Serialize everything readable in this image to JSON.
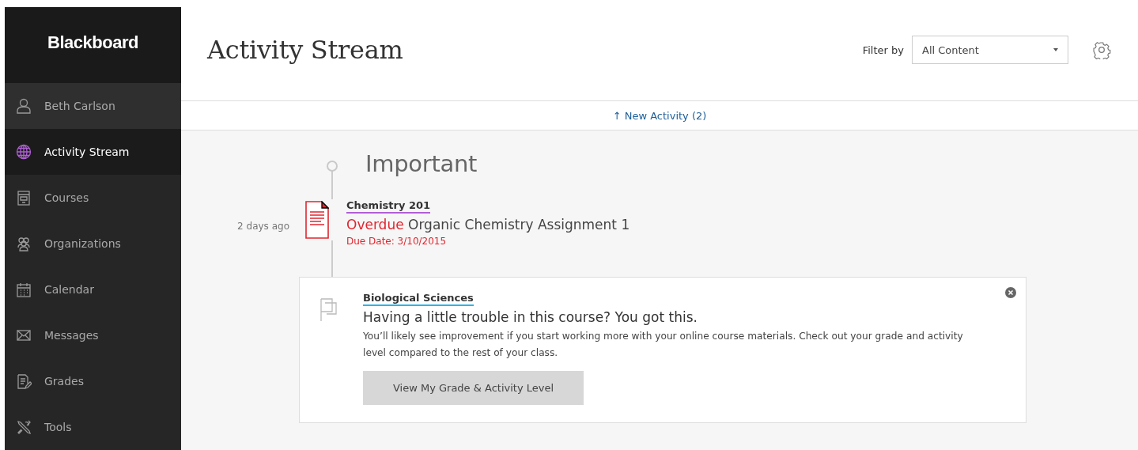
{
  "sidebar": {
    "logo": "Blackboard",
    "items": [
      {
        "label": "Beth Carlson",
        "kind": "profile",
        "selected": false
      },
      {
        "label": "Activity Stream",
        "kind": "nav",
        "selected": true
      },
      {
        "label": "Courses",
        "kind": "nav",
        "selected": false
      },
      {
        "label": "Organizations",
        "kind": "nav",
        "selected": false
      },
      {
        "label": "Calendar",
        "kind": "nav",
        "selected": false
      },
      {
        "label": "Messages",
        "kind": "nav",
        "selected": false
      },
      {
        "label": "Grades",
        "kind": "nav",
        "selected": false
      },
      {
        "label": "Tools",
        "kind": "nav",
        "selected": false
      }
    ]
  },
  "header": {
    "title": "Activity Stream",
    "filter_label": "Filter by",
    "filter_value": "All Content"
  },
  "new_activity": "↑ New Activity (2)",
  "section": {
    "title": "Important"
  },
  "items": [
    {
      "kind": "assignment",
      "time": "2 days ago",
      "course": "Chemistry 201",
      "color": "#b05fd6",
      "status": "Overdue",
      "title": "Organic Chemistry Assignment 1",
      "due": "Due Date: 3/10/2015"
    },
    {
      "kind": "notice",
      "course": "Biological Sciences",
      "color": "#29b6e8",
      "title": "Having a little trouble in this course? You got this.",
      "body": "You’ll likely see improvement if you start working more with your online course materials. Check out your grade and activity level compared to the rest of your class.",
      "button": "View My Grade & Activity Level"
    }
  ]
}
